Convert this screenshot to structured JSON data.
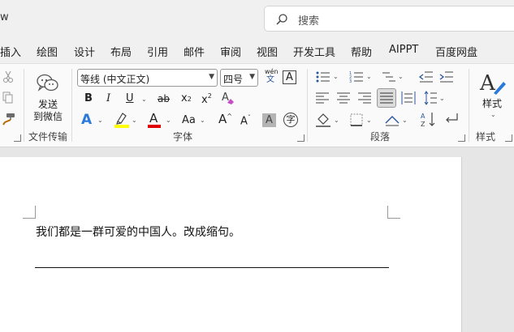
{
  "window": {
    "title_fragment": "w"
  },
  "search": {
    "label": "搜索"
  },
  "tabs": [
    "插入",
    "绘图",
    "设计",
    "布局",
    "引用",
    "邮件",
    "审阅",
    "视图",
    "开发工具",
    "帮助",
    "AIPPT",
    "百度网盘"
  ],
  "ribbon": {
    "send": {
      "label": "发送\n到微信",
      "group": "文件传输"
    },
    "font": {
      "name": "等线 (中文正文)",
      "size": "四号",
      "pinyin_top": "wén",
      "pinyin_bottom": "文",
      "border_char": "A",
      "bold": "B",
      "italic": "I",
      "underline": "U",
      "strike": "ab",
      "subscript": "x",
      "subscript_mark": "2",
      "superscript": "x",
      "superscript_mark": "2",
      "clear_format": "A",
      "text_effect": "A",
      "font_color": "A",
      "change_case": "Aa",
      "grow": "A",
      "shrink": "A",
      "char_shading": "A",
      "enclose": "字",
      "group": "字体"
    },
    "paragraph": {
      "group": "段落"
    },
    "styles": {
      "label": "样式",
      "group": "样式"
    }
  },
  "colors": {
    "highlight": "#ffff00",
    "font_color": "#e00000",
    "accent": "#2b579a"
  },
  "document": {
    "text": "我们都是一群可爱的中国人。改成缩句。"
  }
}
